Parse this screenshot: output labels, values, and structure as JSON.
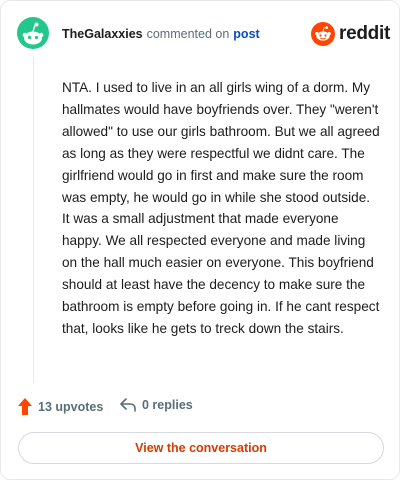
{
  "header": {
    "username": "TheGalaxxies",
    "connector": "commented on",
    "post_link": "post",
    "brand_word": "reddit"
  },
  "comment": {
    "body": "NTA. I used to live in an all girls wing of a dorm. My hallmates would have boyfriends over. They \"weren't allowed\" to use our girls bathroom. But we all agreed as long as they were respectful we didnt care. The girlfriend would go in first and make sure the room was empty, he would go in while she stood outside. It was a small adjustment that made everyone happy. We all respected everyone and made living on the hall much easier on everyone. This boyfriend should at least have the decency to make sure the bathroom is empty before going in. If he cant respect that, looks like he gets to treck down the stairs."
  },
  "actions": {
    "upvotes_label": "13 upvotes",
    "replies_label": "0 replies"
  },
  "footer": {
    "view_button": "View the conversation"
  },
  "icons": {
    "avatar": "snoo-avatar-icon",
    "brand": "reddit-logo-icon",
    "upvote": "upvote-arrow-icon",
    "reply": "reply-arrow-icon"
  },
  "colors": {
    "avatar_bg": "#21c78d",
    "brand_orange": "#ff4500",
    "upvote_orange": "#ff4500",
    "link_blue": "#0a4cbf",
    "button_text": "#d93a00",
    "muted_text": "#576f76"
  }
}
